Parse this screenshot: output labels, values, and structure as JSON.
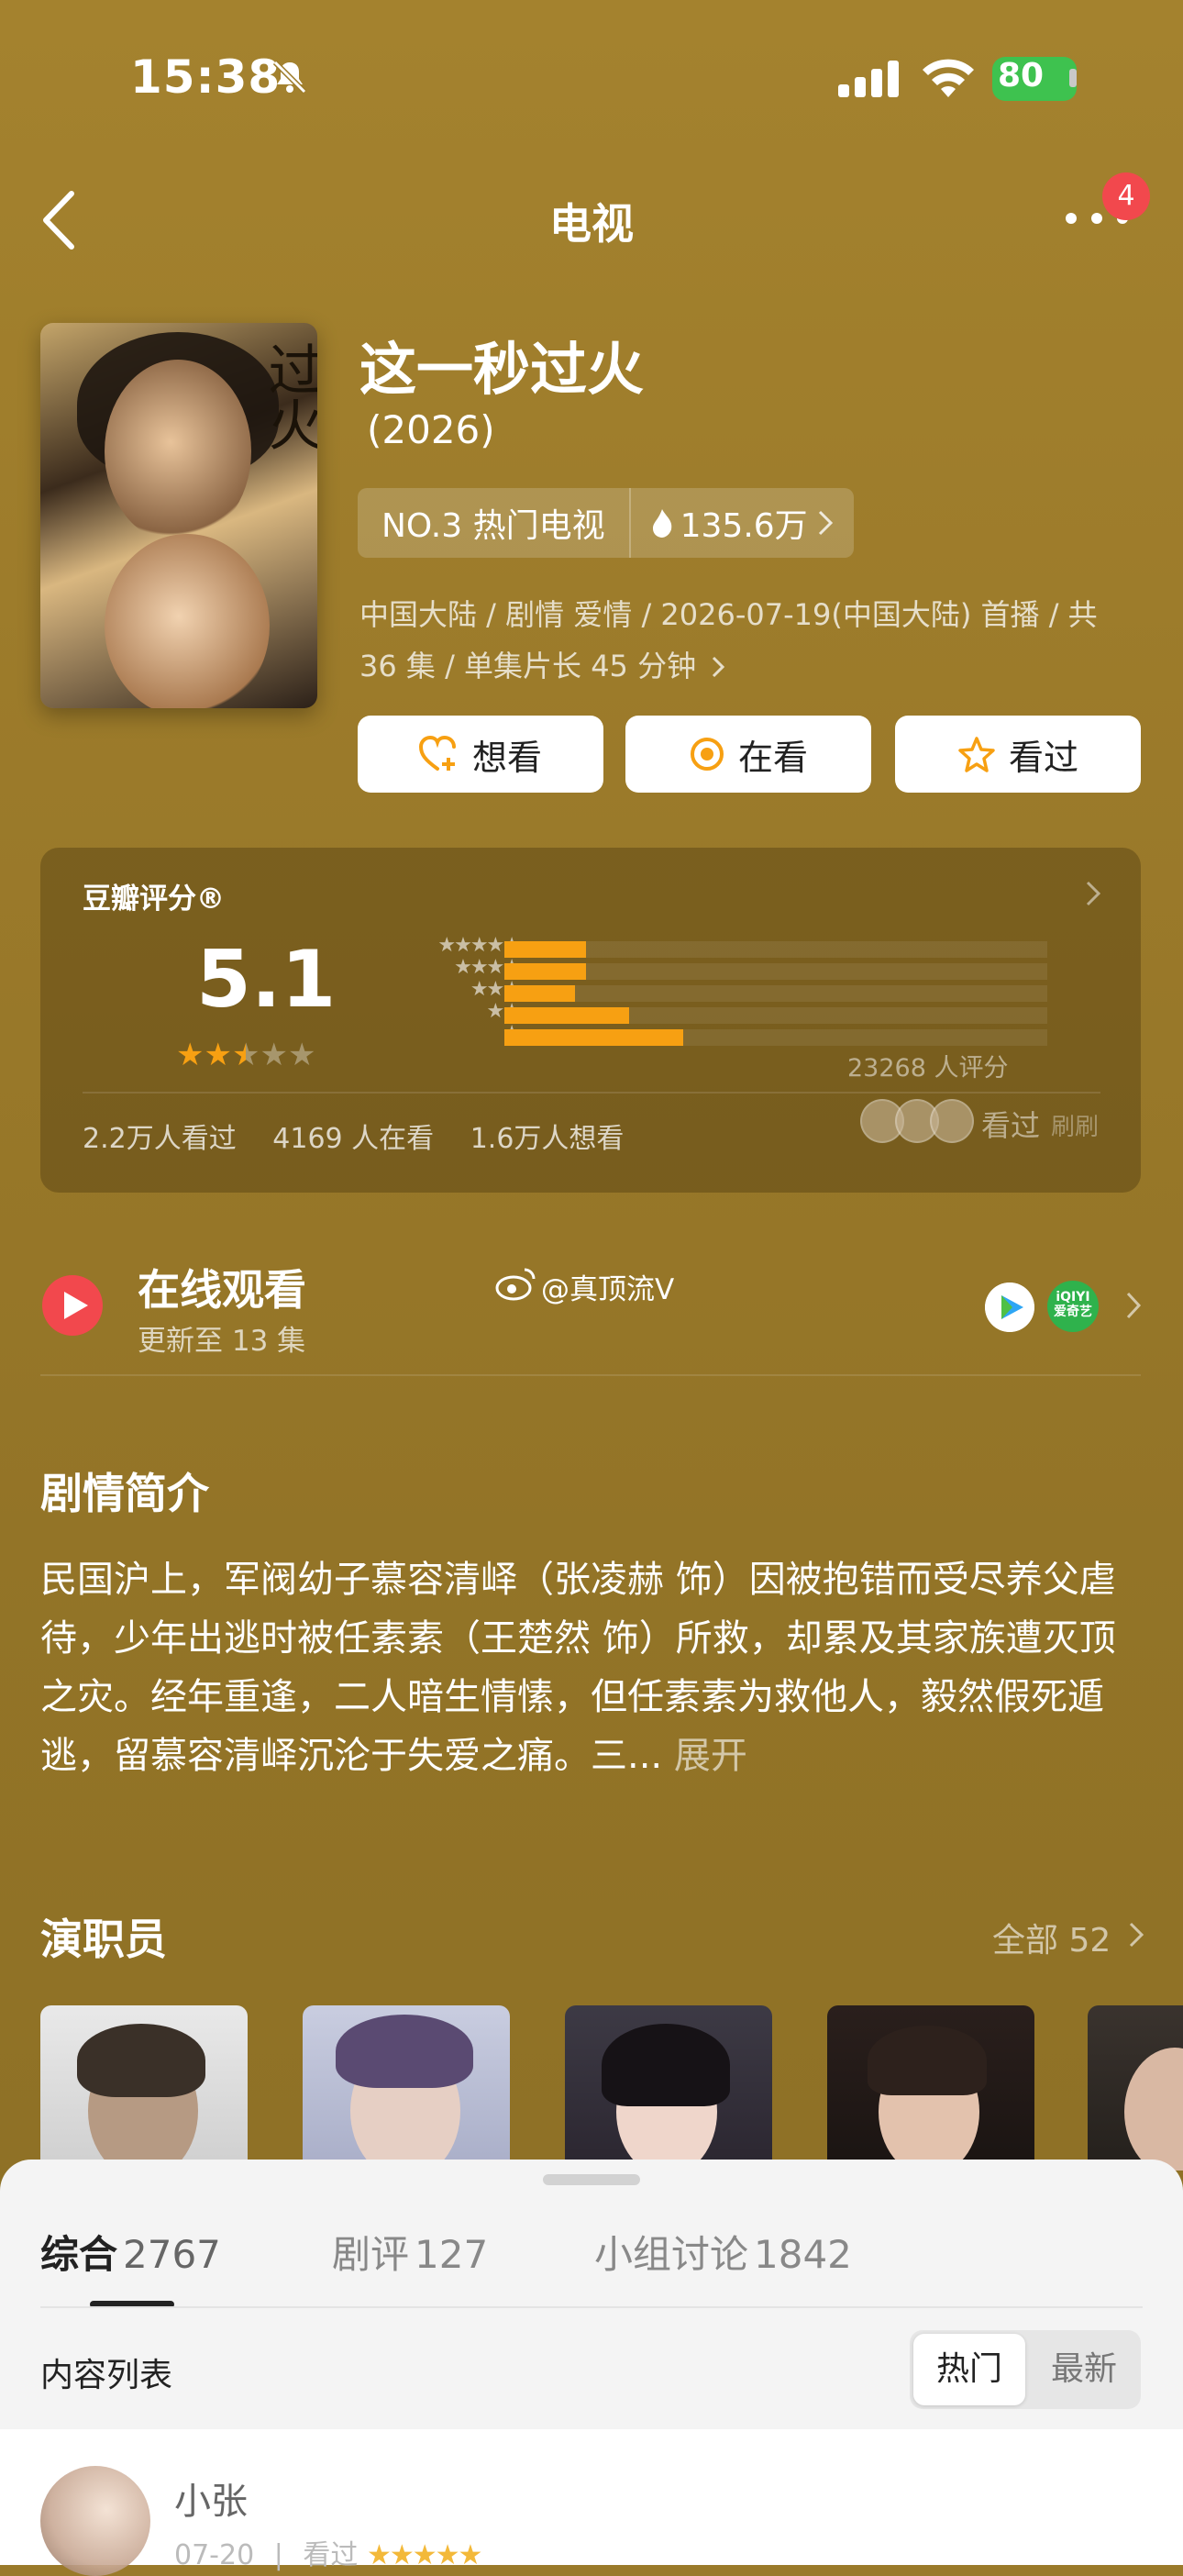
{
  "status_bar": {
    "time": "15:38",
    "battery": "80"
  },
  "nav": {
    "title": "电视",
    "badge": "4"
  },
  "show": {
    "title": "这一秒过火",
    "year": "(2026)",
    "rank": "NO.3 热门电视",
    "heat": "135.6万",
    "meta": "中国大陆 / 剧情 爱情 / 2026-07-19(中国大陆) 首播 / 共 36 集 / 单集片长 45 分钟",
    "poster_text": "过火"
  },
  "actions": {
    "want": "想看",
    "watching": "在看",
    "watched": "看过"
  },
  "rating": {
    "label": "豆瓣评分®",
    "score": "5.1",
    "stars": 2.5,
    "distribution": [
      {
        "stars": "★★★★★",
        "percent": 15
      },
      {
        "stars": "★★★★",
        "percent": 15
      },
      {
        "stars": "★★★",
        "percent": 13
      },
      {
        "stars": "★★",
        "percent": 23
      },
      {
        "stars": "★",
        "percent": 33
      }
    ],
    "count": "23268 人评分",
    "stats": [
      "2.2万人看过",
      "4169 人在看",
      "1.6万人想看"
    ],
    "watched_label": "看过",
    "refresh_label": "刷刷"
  },
  "online": {
    "title": "在线观看",
    "subtitle": "更新至 13 集",
    "weibo": "@真顶流V",
    "app2_text": "iQIYI 爱奇艺"
  },
  "synopsis": {
    "title": "剧情简介",
    "text": "民国沪上，军阀幼子慕容清峄（张凌赫 饰）因被抱错而受尽养父虐待，少年出逃时被任素素（王楚然 饰）所救，却累及其家族遭灭顶之灾。经年重逢，二人暗生情愫，但任素素为救他人，毅然假死遁逃，留慕容清峄沉沦于失爱之痛。三...",
    "more": "展开"
  },
  "cast": {
    "title": "演职员",
    "all": "全部 52"
  },
  "sheet": {
    "tabs": [
      {
        "label": "综合",
        "count": "2767"
      },
      {
        "label": "剧评",
        "count": "127"
      },
      {
        "label": "小组讨论",
        "count": "1842"
      }
    ],
    "list_label": "内容列表",
    "sort_hot": "热门",
    "sort_new": "最新",
    "comment": {
      "name": "小张",
      "date": "07-20",
      "status": "看过",
      "stars": "★★★★★"
    }
  },
  "colors": {
    "accent": "#f7a012",
    "badge": "#f2484d",
    "play": "#f2484d"
  }
}
